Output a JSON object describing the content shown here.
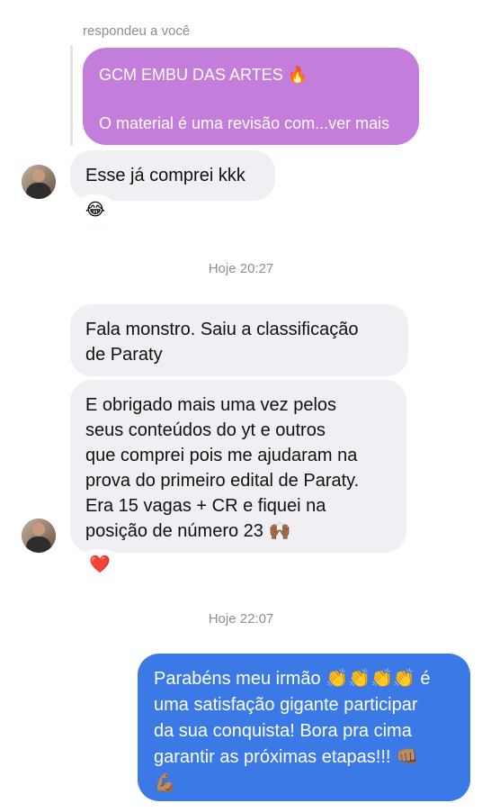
{
  "reply": {
    "label": "respondeu a você",
    "title": "GCM EMBU DAS ARTES 🔥",
    "preview": "O material é uma revisão com...ver mais"
  },
  "messages": {
    "m1": {
      "text": "Esse já comprei kkk",
      "reaction": "😂"
    },
    "ts1": "Hoje 20:27",
    "m2": {
      "line1": "Fala monstro. Saiu a classificação",
      "line2": "de Paraty"
    },
    "m3": {
      "lines": [
        "E obrigado mais uma vez pelos",
        "seus conteúdos do yt e outros",
        "que comprei pois me ajudaram na",
        "prova do primeiro edital de Paraty.",
        "Era 15 vagas + CR e fiquei na",
        "posição de número 23 🙌🏾"
      ],
      "reaction": "❤️"
    },
    "ts2": "Hoje 22:07",
    "m4": {
      "lines": [
        "Parabéns meu irmão 👏👏👏👏 é",
        "uma satisfação gigante participar",
        "da sua conquista! Bora pra cima",
        "garantir as próximas etapas!!! 👊🏽",
        "💪🏽"
      ]
    }
  },
  "colors": {
    "reply_bubble": "#c47ddb",
    "incoming_bubble": "#efeff4",
    "outgoing_bubble": "#3b79e6",
    "timestamp_text": "#8e8e8e"
  }
}
